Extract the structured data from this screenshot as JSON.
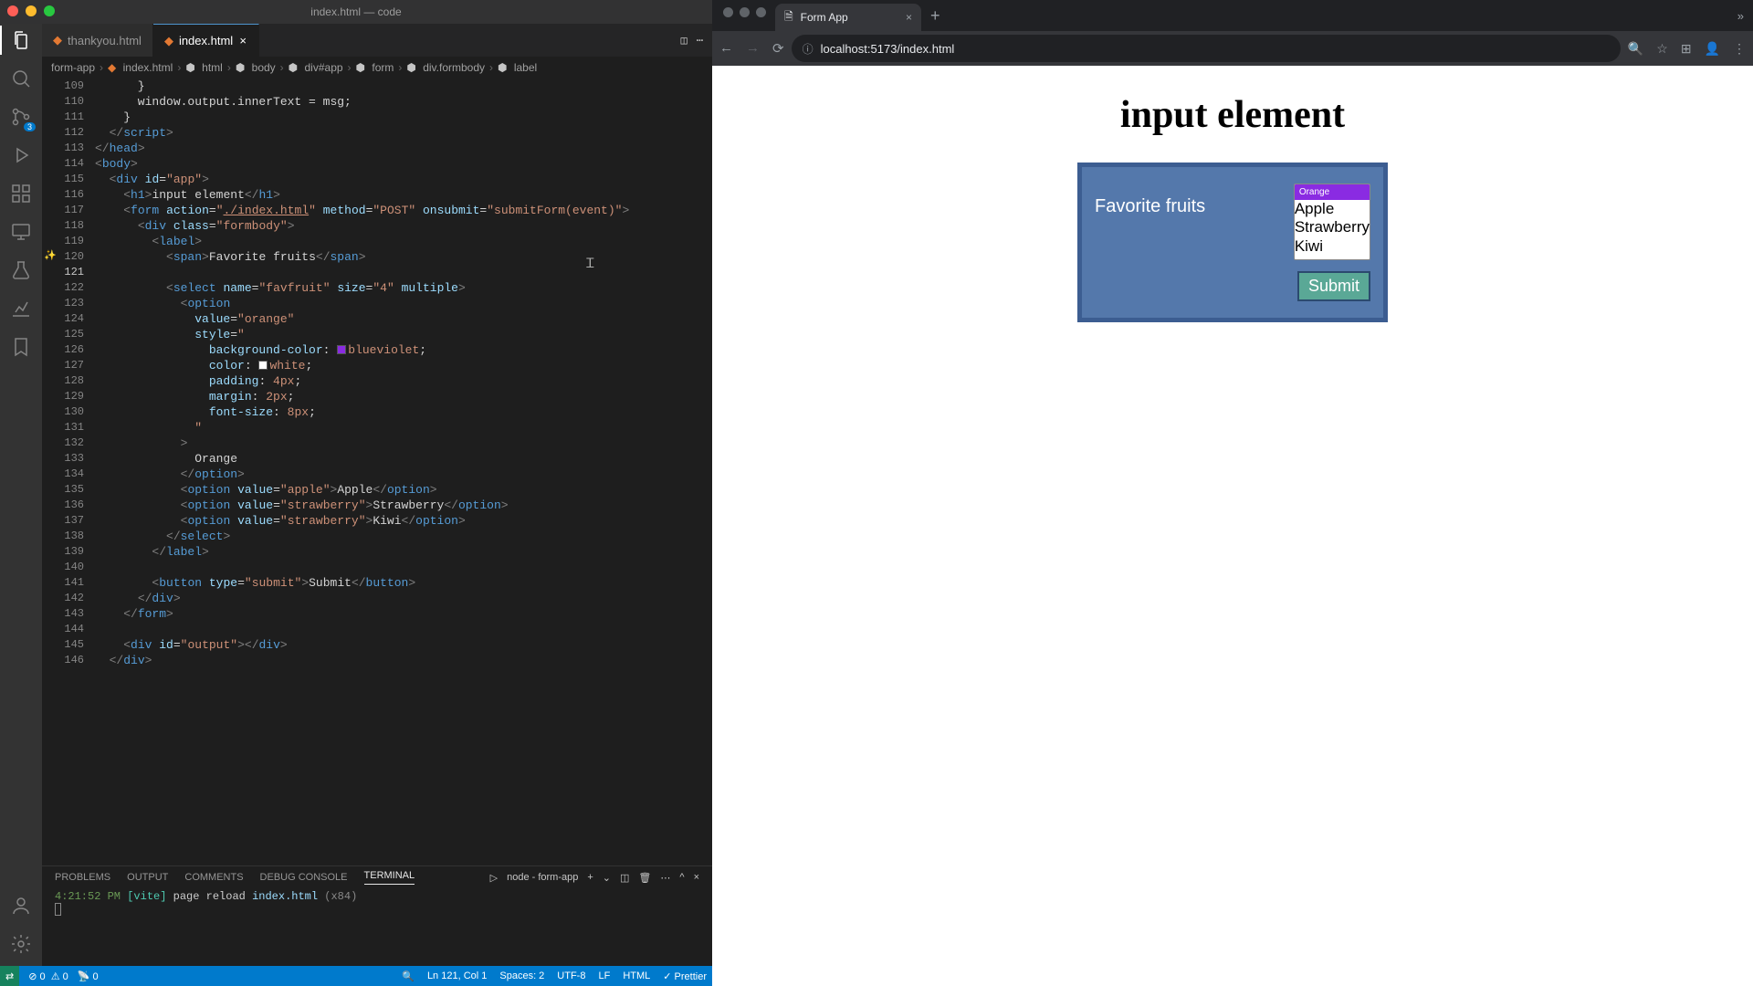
{
  "vscode": {
    "title": "index.html — code",
    "tabs": [
      {
        "label": "thankyou.html",
        "active": false
      },
      {
        "label": "index.html",
        "active": true
      }
    ],
    "scm_badge": "3",
    "breadcrumb": [
      "form-app",
      "index.html",
      "html",
      "body",
      "div#app",
      "form",
      "div.formbody",
      "label"
    ],
    "code": [
      {
        "n": 109,
        "html": "      }"
      },
      {
        "n": 110,
        "html": "      window.output.innerText = msg;"
      },
      {
        "n": 111,
        "html": "    }"
      },
      {
        "n": 112,
        "html": "  <span class='t-pun'>&lt;/</span><span class='t-tag'>script</span><span class='t-pun'>&gt;</span>"
      },
      {
        "n": 113,
        "html": "<span class='t-pun'>&lt;/</span><span class='t-tag'>head</span><span class='t-pun'>&gt;</span>"
      },
      {
        "n": 114,
        "html": "<span class='t-pun'>&lt;</span><span class='t-tag'>body</span><span class='t-pun'>&gt;</span>"
      },
      {
        "n": 115,
        "html": "  <span class='t-pun'>&lt;</span><span class='t-tag'>div</span> <span class='t-attr'>id</span>=<span class='t-str'>\"app\"</span><span class='t-pun'>&gt;</span>"
      },
      {
        "n": 116,
        "html": "    <span class='t-pun'>&lt;</span><span class='t-tag'>h1</span><span class='t-pun'>&gt;</span><span class='t-text'>input element</span><span class='t-pun'>&lt;/</span><span class='t-tag'>h1</span><span class='t-pun'>&gt;</span>"
      },
      {
        "n": 117,
        "html": "    <span class='t-pun'>&lt;</span><span class='t-tag'>form</span> <span class='t-attr'>action</span>=<span class='t-str'>\"<u>./index.html</u>\"</span> <span class='t-attr'>method</span>=<span class='t-str'>\"POST\"</span> <span class='t-attr'>onsubmit</span>=<span class='t-str'>\"submitForm(event)\"</span><span class='t-pun'>&gt;</span>"
      },
      {
        "n": 118,
        "html": "      <span class='t-pun'>&lt;</span><span class='t-tag'>div</span> <span class='t-attr'>class</span>=<span class='t-str'>\"formbody\"</span><span class='t-pun'>&gt;</span>"
      },
      {
        "n": 119,
        "html": "        <span class='t-pun'>&lt;</span><span class='t-tag'>label</span><span class='t-pun'>&gt;</span>"
      },
      {
        "n": 120,
        "glyph": "✨",
        "html": "          <span class='t-pun'>&lt;</span><span class='t-tag'>span</span><span class='t-pun'>&gt;</span><span class='t-text'>Favorite fruits</span><span class='t-pun'>&lt;/</span><span class='t-tag'>span</span><span class='t-pun'>&gt;</span>"
      },
      {
        "n": 121,
        "cur": true,
        "html": ""
      },
      {
        "n": 122,
        "html": "          <span class='t-pun'>&lt;</span><span class='t-tag'>select</span> <span class='t-attr'>name</span>=<span class='t-str'>\"favfruit\"</span> <span class='t-attr'>size</span>=<span class='t-str'>\"4\"</span> <span class='t-attr'>multiple</span><span class='t-pun'>&gt;</span>"
      },
      {
        "n": 123,
        "html": "            <span class='t-pun'>&lt;</span><span class='t-tag'>option</span>"
      },
      {
        "n": 124,
        "html": "              <span class='t-attr'>value</span>=<span class='t-str'>\"orange\"</span>"
      },
      {
        "n": 125,
        "html": "              <span class='t-attr'>style</span>=<span class='t-str'>\"</span>"
      },
      {
        "n": 126,
        "html": "                <span class='t-css'>background-color</span>: <span class='swatch sw-bv'></span><span class='t-cssv'>blueviolet</span>;"
      },
      {
        "n": 127,
        "html": "                <span class='t-css'>color</span>: <span class='swatch sw-wh'></span><span class='t-cssv'>white</span>;"
      },
      {
        "n": 128,
        "html": "                <span class='t-css'>padding</span>: <span class='t-cssv'>4px</span>;"
      },
      {
        "n": 129,
        "html": "                <span class='t-css'>margin</span>: <span class='t-cssv'>2px</span>;"
      },
      {
        "n": 130,
        "html": "                <span class='t-css'>font-size</span>: <span class='t-cssv'>8px</span>;"
      },
      {
        "n": 131,
        "html": "              <span class='t-str'>\"</span>"
      },
      {
        "n": 132,
        "html": "            <span class='t-pun'>&gt;</span>"
      },
      {
        "n": 133,
        "html": "              <span class='t-text'>Orange</span>"
      },
      {
        "n": 134,
        "html": "            <span class='t-pun'>&lt;/</span><span class='t-tag'>option</span><span class='t-pun'>&gt;</span>"
      },
      {
        "n": 135,
        "html": "            <span class='t-pun'>&lt;</span><span class='t-tag'>option</span> <span class='t-attr'>value</span>=<span class='t-str'>\"apple\"</span><span class='t-pun'>&gt;</span><span class='t-text'>Apple</span><span class='t-pun'>&lt;/</span><span class='t-tag'>option</span><span class='t-pun'>&gt;</span>"
      },
      {
        "n": 136,
        "html": "            <span class='t-pun'>&lt;</span><span class='t-tag'>option</span> <span class='t-attr'>value</span>=<span class='t-str'>\"strawberry\"</span><span class='t-pun'>&gt;</span><span class='t-text'>Strawberry</span><span class='t-pun'>&lt;/</span><span class='t-tag'>option</span><span class='t-pun'>&gt;</span>"
      },
      {
        "n": 137,
        "html": "            <span class='t-pun'>&lt;</span><span class='t-tag'>option</span> <span class='t-attr'>value</span>=<span class='t-str'>\"strawberry\"</span><span class='t-pun'>&gt;</span><span class='t-text'>Kiwi</span><span class='t-pun'>&lt;/</span><span class='t-tag'>option</span><span class='t-pun'>&gt;</span>"
      },
      {
        "n": 138,
        "html": "          <span class='t-pun'>&lt;/</span><span class='t-tag'>select</span><span class='t-pun'>&gt;</span>"
      },
      {
        "n": 139,
        "html": "        <span class='t-pun'>&lt;/</span><span class='t-tag'>label</span><span class='t-pun'>&gt;</span>"
      },
      {
        "n": 140,
        "html": ""
      },
      {
        "n": 141,
        "html": "        <span class='t-pun'>&lt;</span><span class='t-tag'>button</span> <span class='t-attr'>type</span>=<span class='t-str'>\"submit\"</span><span class='t-pun'>&gt;</span><span class='t-text'>Submit</span><span class='t-pun'>&lt;/</span><span class='t-tag'>button</span><span class='t-pun'>&gt;</span>"
      },
      {
        "n": 142,
        "html": "      <span class='t-pun'>&lt;/</span><span class='t-tag'>div</span><span class='t-pun'>&gt;</span>"
      },
      {
        "n": 143,
        "html": "    <span class='t-pun'>&lt;/</span><span class='t-tag'>form</span><span class='t-pun'>&gt;</span>"
      },
      {
        "n": 144,
        "html": ""
      },
      {
        "n": 145,
        "html": "    <span class='t-pun'>&lt;</span><span class='t-tag'>div</span> <span class='t-attr'>id</span>=<span class='t-str'>\"output\"</span><span class='t-pun'>&gt;&lt;/</span><span class='t-tag'>div</span><span class='t-pun'>&gt;</span>"
      },
      {
        "n": 146,
        "html": "  <span class='t-pun'>&lt;/</span><span class='t-tag'>div</span><span class='t-pun'>&gt;</span>"
      }
    ],
    "panel": {
      "tabs": [
        "PROBLEMS",
        "OUTPUT",
        "COMMENTS",
        "DEBUG CONSOLE",
        "TERMINAL"
      ],
      "active_tab": "TERMINAL",
      "task": "node - form-app",
      "term_time": "4:21:52 PM",
      "term_tag": "[vite]",
      "term_msg": "page reload",
      "term_file": "index.html",
      "term_count": "(x84)"
    },
    "status": {
      "errors": "0",
      "warnings": "0",
      "ports": "0",
      "position": "Ln 121, Col 1",
      "spaces": "Spaces: 2",
      "encoding": "UTF-8",
      "eol": "LF",
      "lang": "HTML",
      "formatter": "✓ Prettier"
    }
  },
  "browser": {
    "tab_title": "Form App",
    "url": "localhost:5173/index.html",
    "page": {
      "heading": "input element",
      "label": "Favorite fruits",
      "options": [
        "Orange",
        "Apple",
        "Strawberry",
        "Kiwi"
      ],
      "submit": "Submit"
    }
  }
}
